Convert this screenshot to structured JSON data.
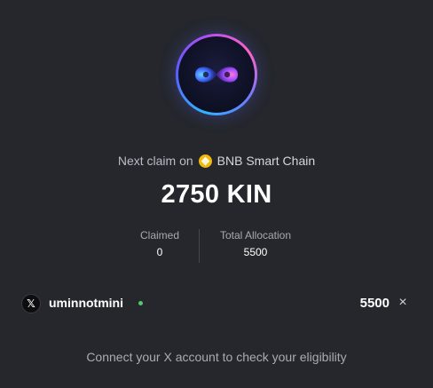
{
  "claim": {
    "prefix": "Next claim on",
    "chain_icon": "bnb-chain-icon",
    "chain_name": "BNB Smart Chain",
    "amount": "2750 KIN"
  },
  "stats": {
    "claimed_label": "Claimed",
    "claimed_value": "0",
    "total_label": "Total Allocation",
    "total_value": "5500"
  },
  "account": {
    "icon": "x-logo-icon",
    "avatar_glyph": "𝕏",
    "username": "uminnotmini",
    "status_color": "#52c96b",
    "amount": "5500",
    "close_glyph": "×"
  },
  "footer": {
    "connect_text": "Connect your X account to check your eligibility"
  },
  "colors": {
    "background": "#25272d",
    "bnb": "#f0b90b"
  }
}
